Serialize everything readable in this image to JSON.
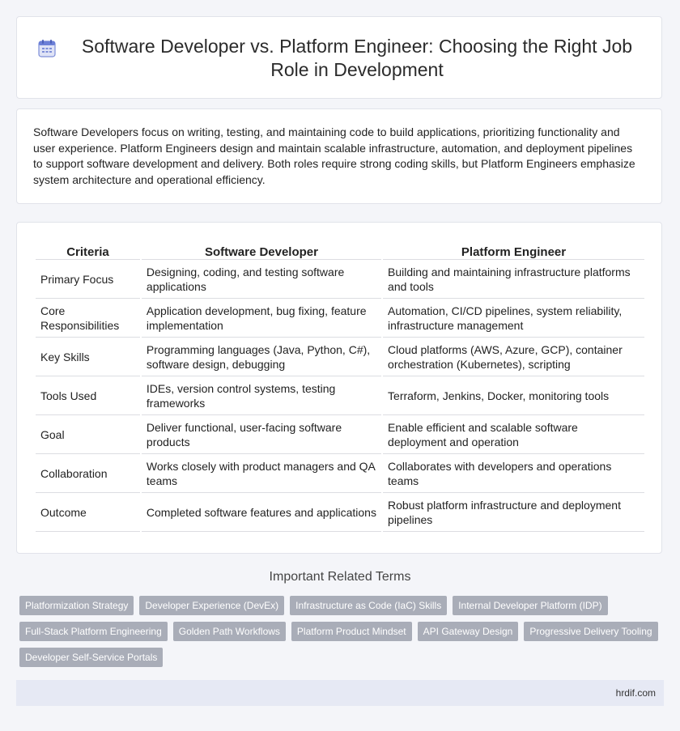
{
  "header": {
    "title": "Software Developer vs. Platform Engineer: Choosing the Right Job Role in Development",
    "icon": "calendar-icon"
  },
  "intro": {
    "text": "Software Developers focus on writing, testing, and maintaining code to build applications, prioritizing functionality and user experience. Platform Engineers design and maintain scalable infrastructure, automation, and deployment pipelines to support software development and delivery. Both roles require strong coding skills, but Platform Engineers emphasize system architecture and operational efficiency."
  },
  "table": {
    "headers": [
      "Criteria",
      "Software Developer",
      "Platform Engineer"
    ],
    "rows": [
      [
        "Primary Focus",
        "Designing, coding, and testing software applications",
        "Building and maintaining infrastructure platforms and tools"
      ],
      [
        "Core Responsibilities",
        "Application development, bug fixing, feature implementation",
        "Automation, CI/CD pipelines, system reliability, infrastructure management"
      ],
      [
        "Key Skills",
        "Programming languages (Java, Python, C#), software design, debugging",
        "Cloud platforms (AWS, Azure, GCP), container orchestration (Kubernetes), scripting"
      ],
      [
        "Tools Used",
        "IDEs, version control systems, testing frameworks",
        "Terraform, Jenkins, Docker, monitoring tools"
      ],
      [
        "Goal",
        "Deliver functional, user-facing software products",
        "Enable efficient and scalable software deployment and operation"
      ],
      [
        "Collaboration",
        "Works closely with product managers and QA teams",
        "Collaborates with developers and operations teams"
      ],
      [
        "Outcome",
        "Completed software features and applications",
        "Robust platform infrastructure and deployment pipelines"
      ]
    ]
  },
  "related": {
    "heading": "Important Related Terms",
    "tags": [
      "Platformization Strategy",
      "Developer Experience (DevEx)",
      "Infrastructure as Code (IaC) Skills",
      "Internal Developer Platform (IDP)",
      "Full-Stack Platform Engineering",
      "Golden Path Workflows",
      "Platform Product Mindset",
      "API Gateway Design",
      "Progressive Delivery Tooling",
      "Developer Self-Service Portals"
    ]
  },
  "footer": {
    "text": "hrdif.com"
  },
  "colors": {
    "accent": "#6b7fd7",
    "tag_bg": "#a9adb8",
    "footer_bg": "#e6e9f4"
  }
}
